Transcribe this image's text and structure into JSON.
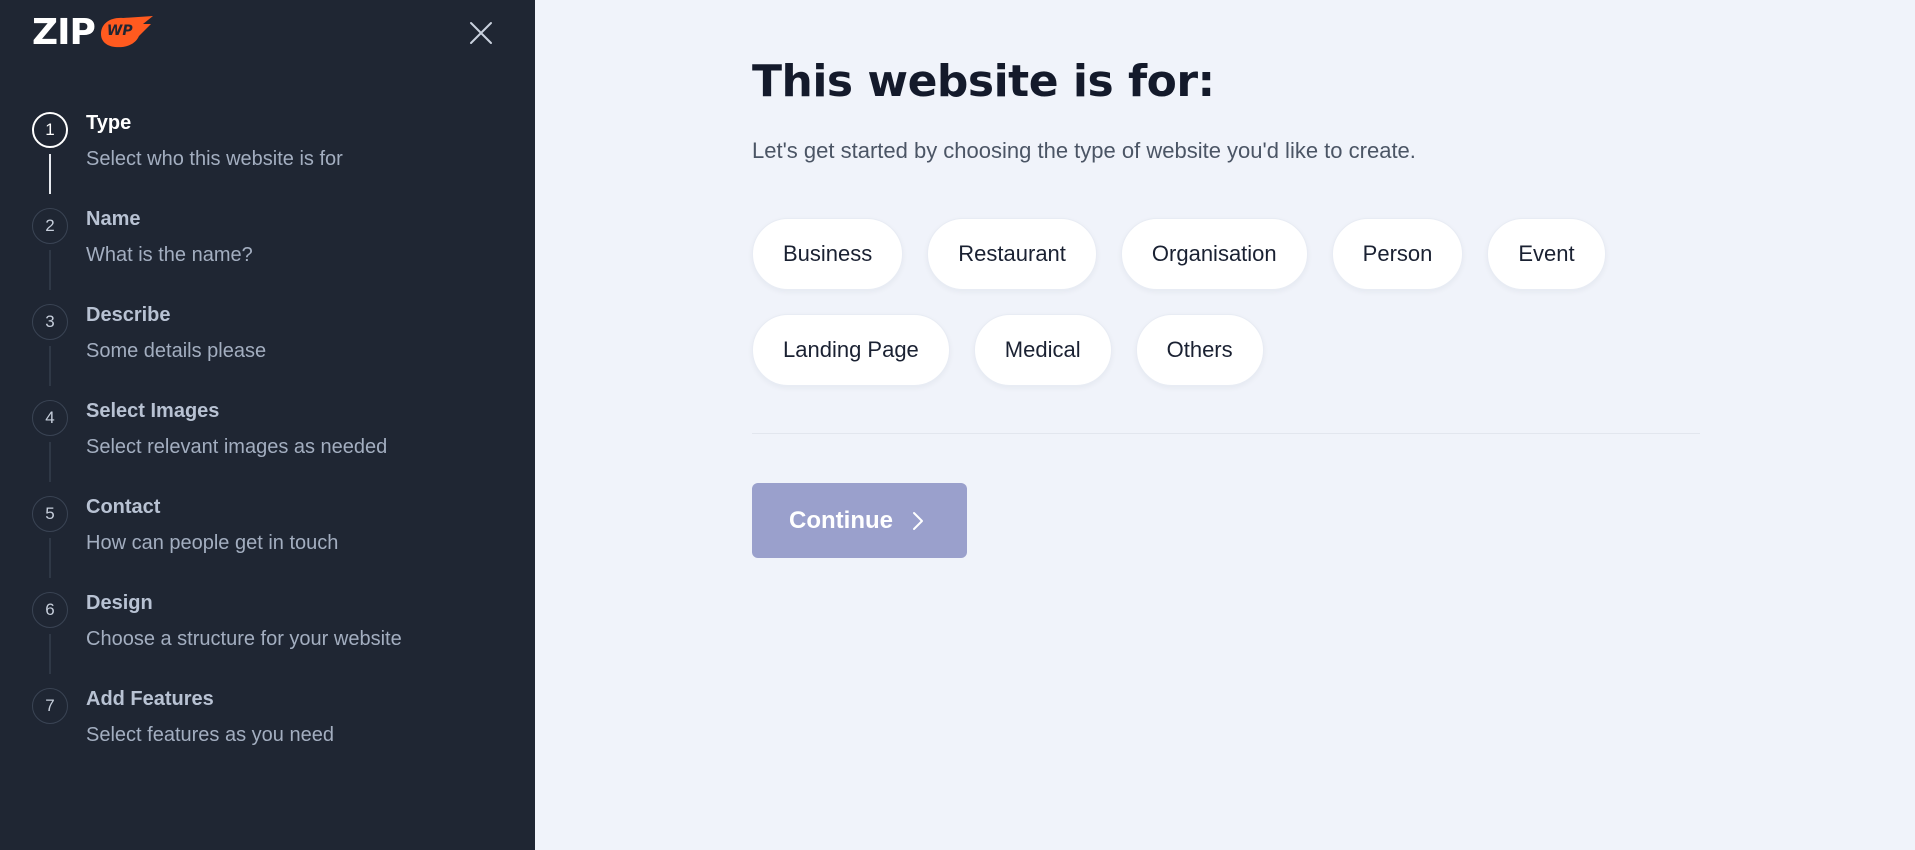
{
  "sidebar": {
    "logo_text": "ZIP",
    "logo_badge": "WP",
    "steps": [
      {
        "num": "1",
        "title": "Type",
        "sub": "Select who this website is for"
      },
      {
        "num": "2",
        "title": "Name",
        "sub": "What is the name?"
      },
      {
        "num": "3",
        "title": "Describe",
        "sub": "Some details please"
      },
      {
        "num": "4",
        "title": "Select Images",
        "sub": "Select relevant images as needed"
      },
      {
        "num": "5",
        "title": "Contact",
        "sub": "How can people get in touch"
      },
      {
        "num": "6",
        "title": "Design",
        "sub": "Choose a structure for your website"
      },
      {
        "num": "7",
        "title": "Add Features",
        "sub": "Select features as you need"
      }
    ]
  },
  "main": {
    "title": "This website is for:",
    "subtitle": "Let's get started by choosing the type of website you'd like to create.",
    "options": [
      "Business",
      "Restaurant",
      "Organisation",
      "Person",
      "Event",
      "Landing Page",
      "Medical",
      "Others"
    ],
    "continue_label": "Continue"
  },
  "colors": {
    "sidebar_bg": "#1f2633",
    "main_bg": "#f0f3fa",
    "logo_accent": "#ff5a1f",
    "continue_bg": "#9aa0cc"
  }
}
